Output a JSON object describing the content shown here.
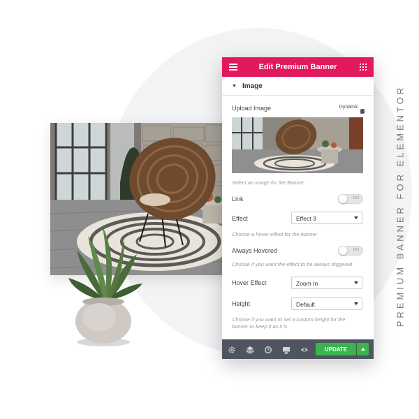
{
  "vertical_text": "PREMIUM BANNER FOR ELEMENTOR",
  "panel": {
    "header_title": "Edit Premium Banner",
    "section_title": "Image",
    "upload_label": "Upload Image",
    "dynamic_label": "Dynamic",
    "upload_hint": "Select an image for the Banner",
    "link_label": "Link",
    "link_toggle": "NO",
    "effect_label": "Effect",
    "effect_value": "Effect 3",
    "effect_hint": "Choose a hover effect for the banner",
    "always_label": "Always Hovered",
    "always_toggle": "NO",
    "always_hint": "Choose if you want the effect to be always triggered",
    "hover_label": "Hover Effect",
    "hover_value": "Zoom In",
    "height_label": "Height",
    "height_value": "Default",
    "height_hint_1": "Choose if you want to set a custom height for the",
    "height_hint_2": "banner or keep it as it is",
    "update_label": "UPDATE"
  },
  "colors": {
    "header_pink": "#e3195d",
    "update_green": "#39b54a",
    "footer_dark": "#4f5560"
  },
  "icons": [
    "hamburger-icon",
    "apps-grid-icon",
    "caret-down-icon",
    "database-icon",
    "gear-icon",
    "layers-icon",
    "history-icon",
    "desktop-icon",
    "eye-icon",
    "chevron-up-icon"
  ]
}
